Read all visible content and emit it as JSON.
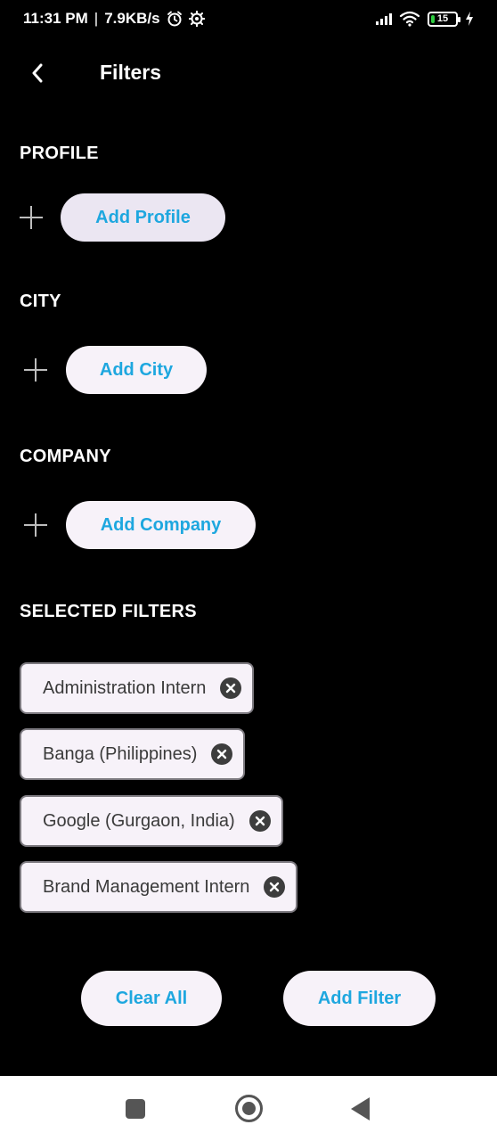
{
  "status_bar": {
    "time": "11:31 PM",
    "separator": "|",
    "network_speed": "7.9KB/s",
    "battery_level": "15",
    "battery_fraction": 0.15,
    "icons": [
      "alarm-icon",
      "settings-icon",
      "signal-icon",
      "wifi-icon",
      "battery-icon",
      "charging-icon"
    ]
  },
  "header": {
    "title": "Filters",
    "back_icon": "chevron-left-icon"
  },
  "sections": {
    "profile": {
      "title": "PROFILE",
      "button_label": "Add Profile"
    },
    "city": {
      "title": "CITY",
      "button_label": "Add City"
    },
    "company": {
      "title": "COMPANY",
      "button_label": "Add Company"
    }
  },
  "selected_filters": {
    "title": "SELECTED FILTERS",
    "chips": [
      {
        "label": "Administration Intern"
      },
      {
        "label": "Banga (Philippines)"
      },
      {
        "label": "Google (Gurgaon, India)"
      },
      {
        "label": "Brand Management Intern"
      }
    ]
  },
  "actions": {
    "clear_all": "Clear All",
    "add_filter": "Add Filter"
  },
  "colors": {
    "background": "#000000",
    "accent": "#1ea7df",
    "pill_background": "#f7f2f9",
    "profile_pill_background": "#ebe6f2"
  }
}
